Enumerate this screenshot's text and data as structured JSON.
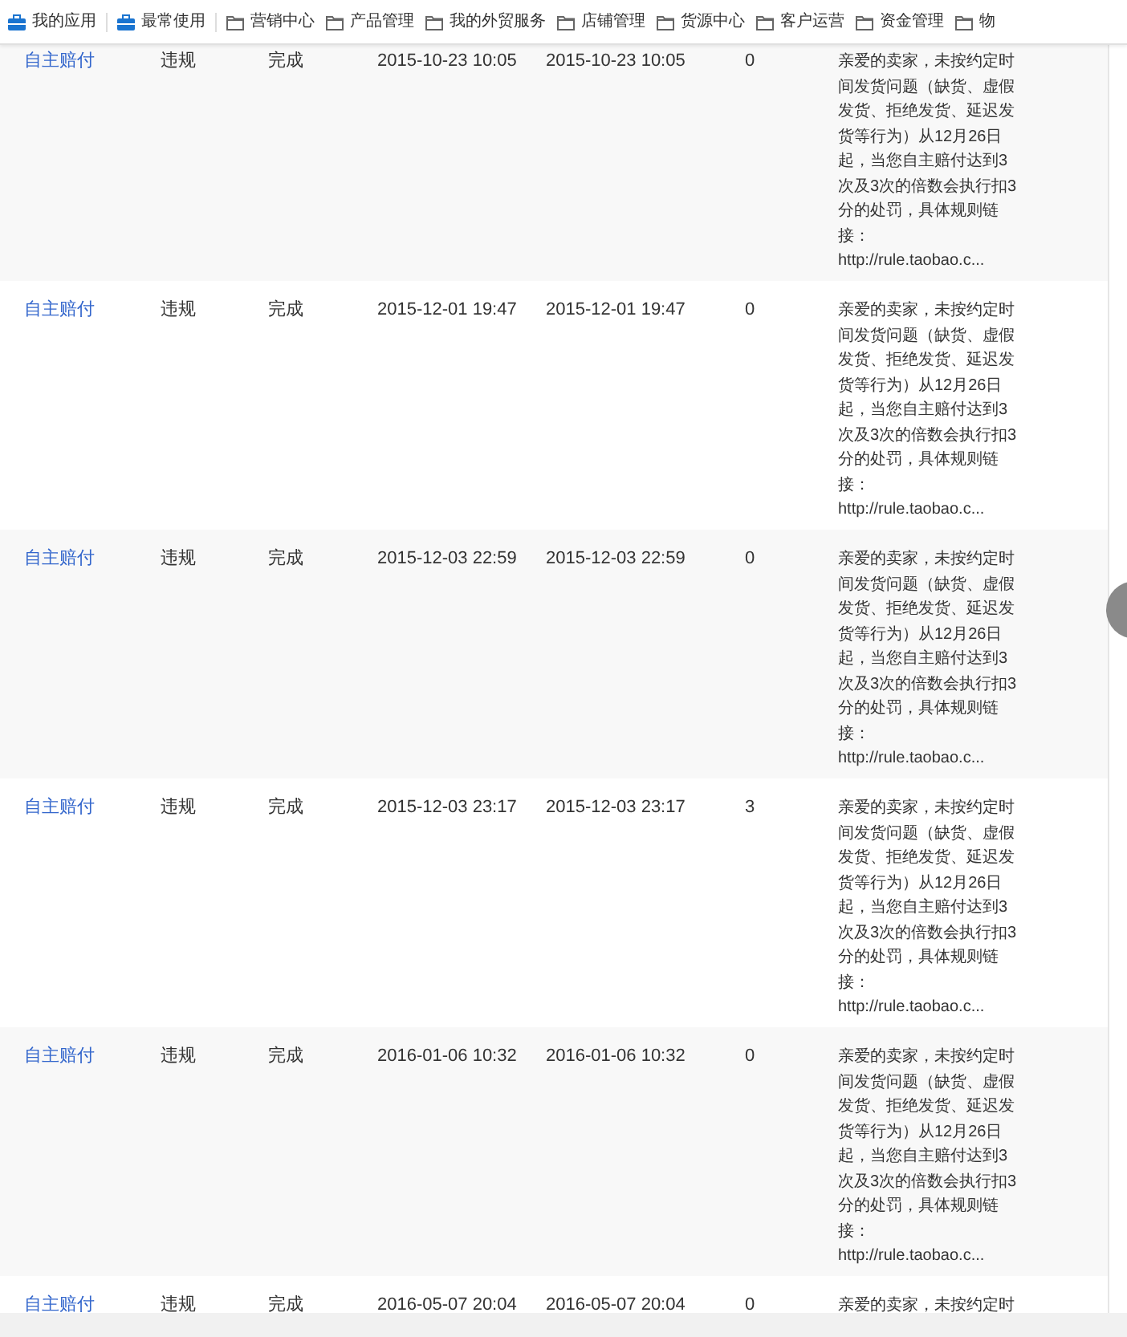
{
  "nav": [
    {
      "kind": "pinned",
      "label": "我的应用"
    },
    {
      "kind": "pinned",
      "label": "最常使用"
    },
    {
      "kind": "folder",
      "label": "营销中心"
    },
    {
      "kind": "folder",
      "label": "产品管理"
    },
    {
      "kind": "folder",
      "label": "我的外贸服务"
    },
    {
      "kind": "folder",
      "label": "店铺管理"
    },
    {
      "kind": "folder",
      "label": "货源中心"
    },
    {
      "kind": "folder",
      "label": "客户运营"
    },
    {
      "kind": "folder",
      "label": "资金管理"
    },
    {
      "kind": "folder",
      "label": "物"
    }
  ],
  "rows": [
    {
      "type": "自主赔付",
      "category": "违规",
      "status": "完成",
      "created": "2015-10-23 10:05",
      "updated": "2015-10-23 10:05",
      "count": "0",
      "description": "亲爱的卖家，未按约定时间发货问题（缺货、虚假发货、拒绝发货、延迟发货等行为）从12月26日起，当您自主赔付达到3次及3次的倍数会执行扣3分的处罚，具体规则链接：",
      "link": "http://rule.taobao.c..."
    },
    {
      "type": "自主赔付",
      "category": "违规",
      "status": "完成",
      "created": "2015-12-01 19:47",
      "updated": "2015-12-01 19:47",
      "count": "0",
      "description": "亲爱的卖家，未按约定时间发货问题（缺货、虚假发货、拒绝发货、延迟发货等行为）从12月26日起，当您自主赔付达到3次及3次的倍数会执行扣3分的处罚，具体规则链接：",
      "link": "http://rule.taobao.c..."
    },
    {
      "type": "自主赔付",
      "category": "违规",
      "status": "完成",
      "created": "2015-12-03 22:59",
      "updated": "2015-12-03 22:59",
      "count": "0",
      "description": "亲爱的卖家，未按约定时间发货问题（缺货、虚假发货、拒绝发货、延迟发货等行为）从12月26日起，当您自主赔付达到3次及3次的倍数会执行扣3分的处罚，具体规则链接：",
      "link": "http://rule.taobao.c..."
    },
    {
      "type": "自主赔付",
      "category": "违规",
      "status": "完成",
      "created": "2015-12-03 23:17",
      "updated": "2015-12-03 23:17",
      "count": "3",
      "description": "亲爱的卖家，未按约定时间发货问题（缺货、虚假发货、拒绝发货、延迟发货等行为）从12月26日起，当您自主赔付达到3次及3次的倍数会执行扣3分的处罚，具体规则链接：",
      "link": "http://rule.taobao.c..."
    },
    {
      "type": "自主赔付",
      "category": "违规",
      "status": "完成",
      "created": "2016-01-06 10:32",
      "updated": "2016-01-06 10:32",
      "count": "0",
      "description": "亲爱的卖家，未按约定时间发货问题（缺货、虚假发货、拒绝发货、延迟发货等行为）从12月26日起，当您自主赔付达到3次及3次的倍数会执行扣3分的处罚，具体规则链接：",
      "link": "http://rule.taobao.c..."
    },
    {
      "type": "自主赔付",
      "category": "违规",
      "status": "完成",
      "created": "2016-05-07 20:04",
      "updated": "2016-05-07 20:04",
      "count": "0",
      "description": "亲爱的卖家，未按约定时"
    }
  ]
}
